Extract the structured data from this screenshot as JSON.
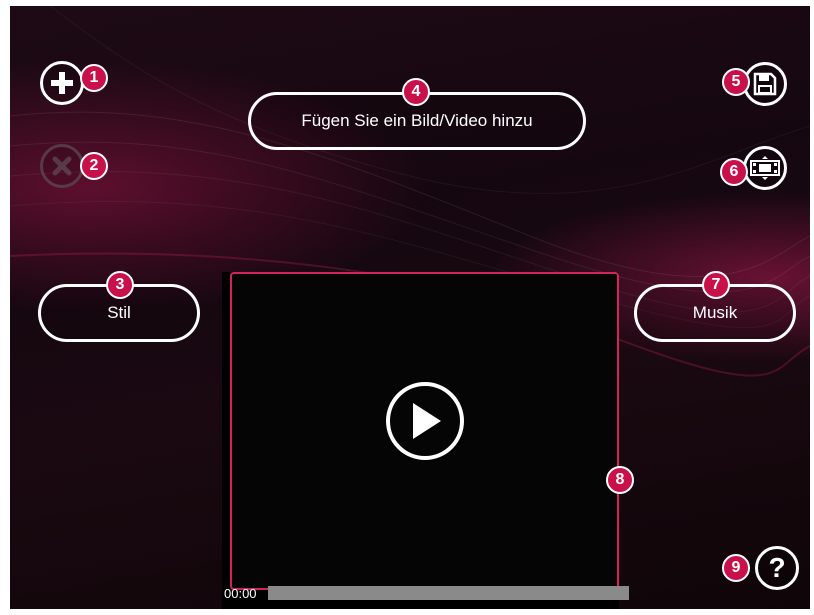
{
  "toolbar": {
    "add_icon": "plus-icon",
    "remove_icon": "close-icon",
    "save_icon": "floppy-disk-icon",
    "video_icon": "film-strip-icon",
    "help_icon": "question-icon",
    "help_glyph": "?"
  },
  "buttons": {
    "add_media_label": "Fügen Sie ein Bild/Video hinzu",
    "style_label": "Stil",
    "music_label": "Musik"
  },
  "badges": [
    "1",
    "2",
    "3",
    "4",
    "5",
    "6",
    "7",
    "8",
    "9"
  ],
  "player": {
    "time": "00:00",
    "progress": 0.0
  },
  "colors": {
    "accent": "#c8104a",
    "video_border": "#d0245a",
    "background": "#1a0911"
  }
}
